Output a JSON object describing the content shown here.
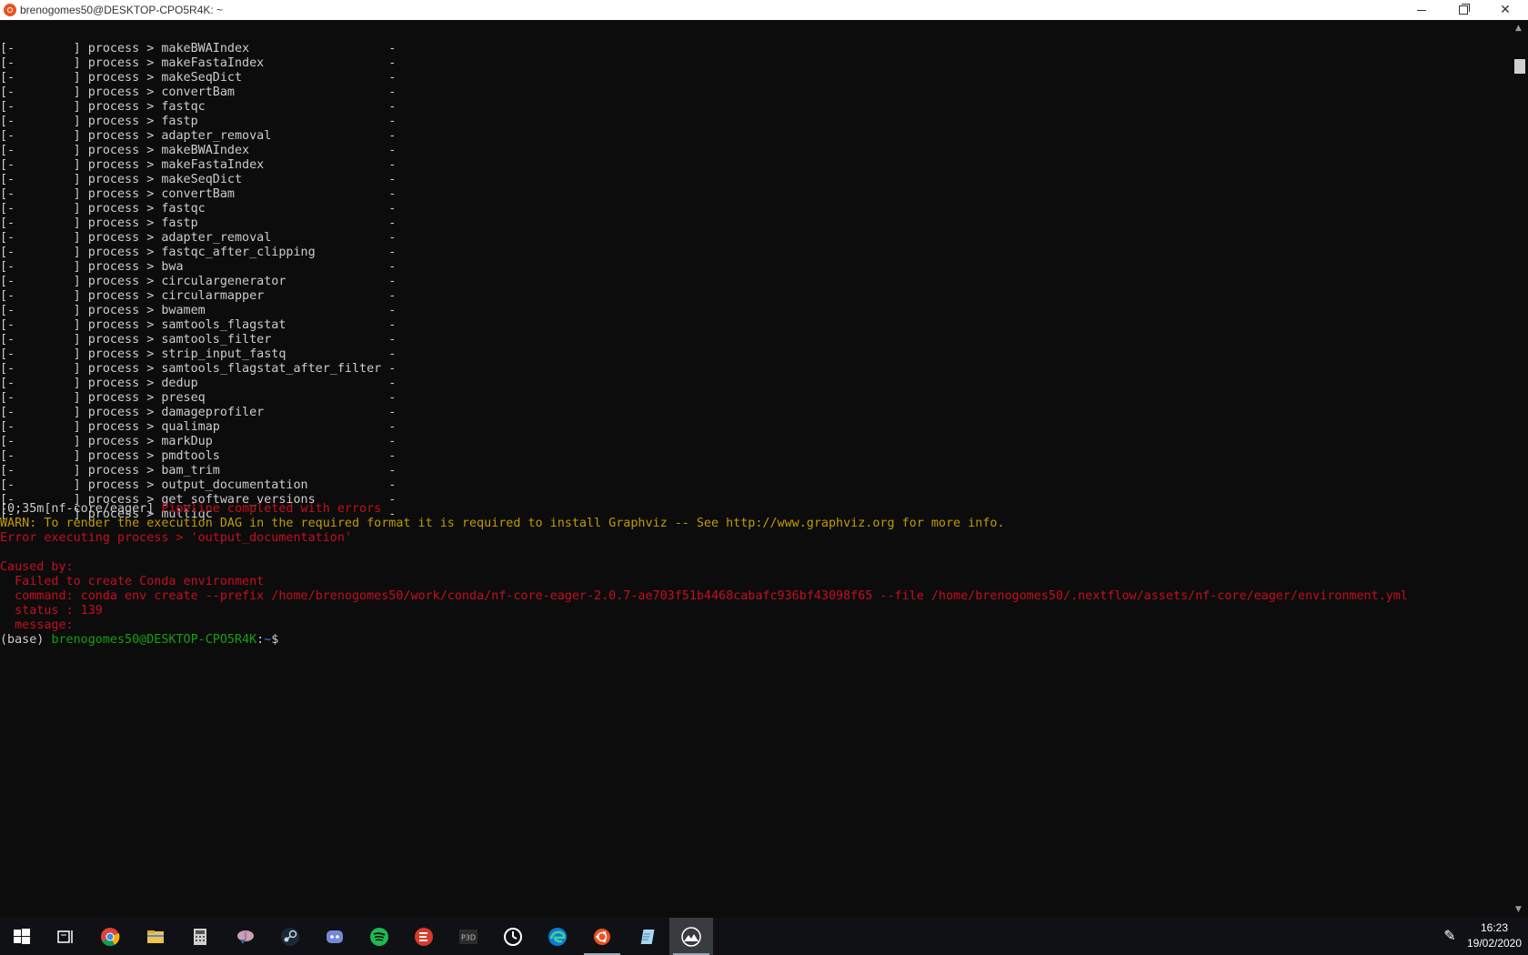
{
  "window": {
    "title": "brenogomes50@DESKTOP-CPO5R4K: ~"
  },
  "terminal": {
    "process_lines": [
      "[-        ] process > makeBWAIndex                   -",
      "[-        ] process > makeFastaIndex                 -",
      "[-        ] process > makeSeqDict                    -",
      "[-        ] process > convertBam                     -",
      "[-        ] process > fastqc                         -",
      "[-        ] process > fastp                          -",
      "[-        ] process > adapter_removal                -",
      "[-        ] process > makeBWAIndex                   -",
      "[-        ] process > makeFastaIndex                 -",
      "[-        ] process > makeSeqDict                    -",
      "[-        ] process > convertBam                     -",
      "[-        ] process > fastqc                         -",
      "[-        ] process > fastp                          -",
      "[-        ] process > adapter_removal                -",
      "[-        ] process > fastqc_after_clipping          -",
      "[-        ] process > bwa                            -",
      "[-        ] process > circulargenerator              -",
      "[-        ] process > circularmapper                 -",
      "[-        ] process > bwamem                         -",
      "[-        ] process > samtools_flagstat              -",
      "[-        ] process > samtools_filter                -",
      "[-        ] process > strip_input_fastq              -",
      "[-        ] process > samtools_flagstat_after_filter -",
      "[-        ] process > dedup                          -",
      "[-        ] process > preseq                         -",
      "[-        ] process > damageprofiler                 -",
      "[-        ] process > qualimap                       -",
      "[-        ] process > markDup                        -",
      "[-        ] process > pmdtools                       -",
      "[-        ] process > bam_trim                       -",
      "[-        ] process > output_documentation           -",
      "[-        ] process > get_software_versions          -",
      "[-        ] process > multiqc                        -"
    ],
    "completed_prefix": "[0;35m[nf-core/eager] ",
    "completed_msg": "Pipeline completed with errors",
    "warn_line": "WARN: To render the execution DAG in the required format it is required to install Graphviz -- See http://www.graphviz.org for more info.",
    "error_line": "Error executing process > 'output_documentation'",
    "caused_by": "Caused by:",
    "failed_line": "  Failed to create Conda environment",
    "command_line": "  command: conda env create --prefix /home/brenogomes50/work/conda/nf-core-eager-2.0.7-ae703f51b4468cabafc936bf43098f65 --file /home/brenogomes50/.nextflow/assets/nf-core/eager/environment.yml",
    "status_line": "  status : 139",
    "message_line": "  message:",
    "prompt": {
      "env": "(base) ",
      "userhost": "brenogomes50@DESKTOP-CPO5R4K",
      "sep": ":",
      "path": "~",
      "symbol": "$"
    }
  },
  "taskbar": {
    "time": "16:23",
    "date": "19/02/2020",
    "icons": [
      "start-windows-icon",
      "task-view-icon",
      "chrome-icon",
      "file-explorer-icon",
      "calculator-icon",
      "brain-app-icon",
      "steam-icon",
      "discord-icon",
      "spotify-icon",
      "rocket-app-icon",
      "p3d-icon",
      "clock-app-icon",
      "edge-icon",
      "ubuntu-icon",
      "notepad-icon",
      "terminal-wsl-icon"
    ],
    "p3d_label": "P3D"
  },
  "colors": {
    "terminal_bg": "#0c0c0c",
    "text": "#cccccc",
    "error_red": "#c50f1f",
    "warn_yellow": "#c19c00",
    "prompt_green": "#13a10e",
    "prompt_blue": "#3b78ff"
  }
}
